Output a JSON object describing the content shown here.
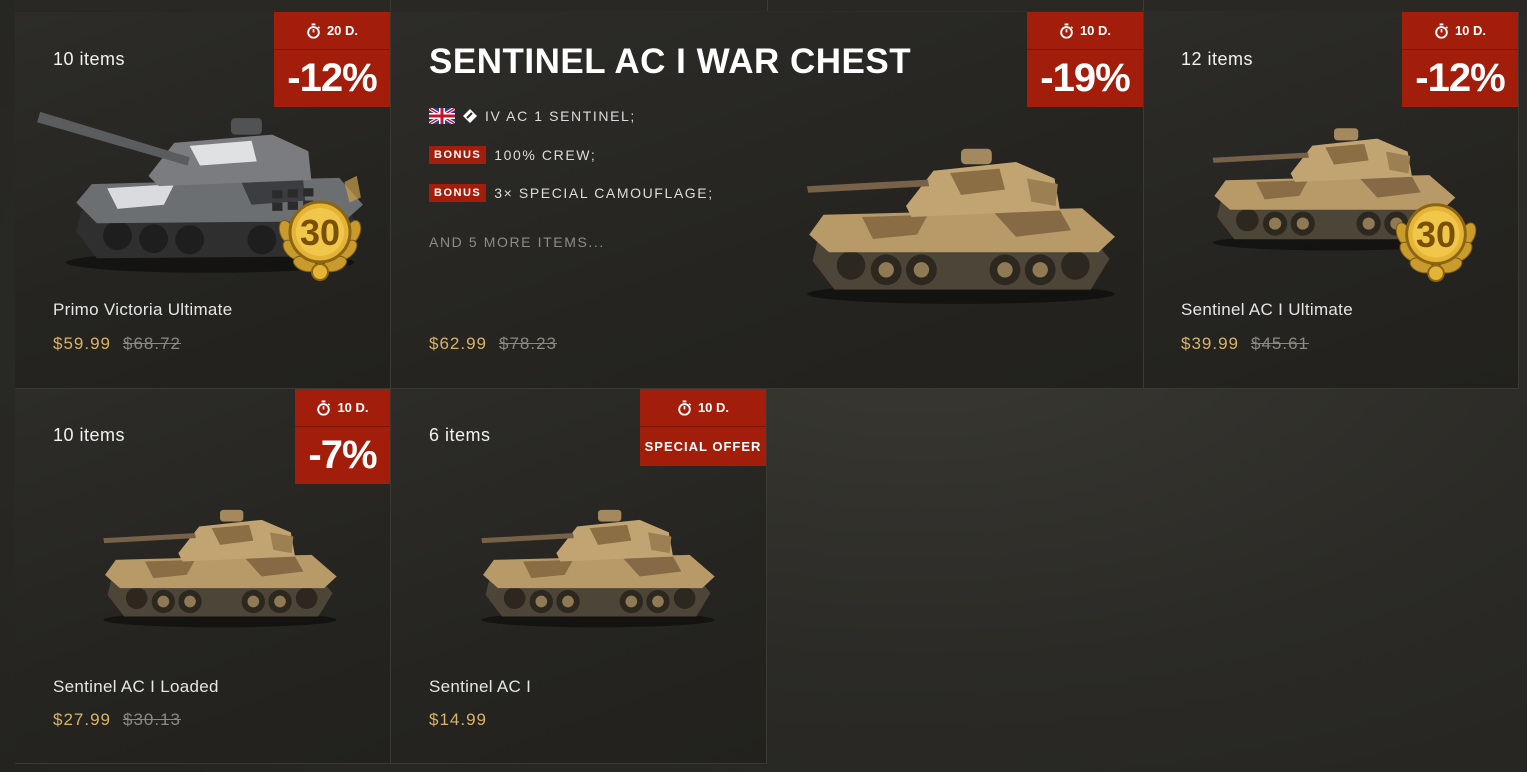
{
  "colors": {
    "badge": "#a21e0b",
    "price": "#d7b46a",
    "old_price": "#8a8a84"
  },
  "cards": [
    {
      "count": "10 items",
      "timer": "20 D.",
      "discount": "-12%",
      "name": "Primo Victoria Ultimate",
      "price": "$59.99",
      "old_price": "$68.72",
      "medal": "30"
    },
    {
      "title": "SENTINEL AC I WAR CHEST",
      "timer": "10 D.",
      "discount": "-19%",
      "features": [
        {
          "text": "IV  AC 1 SENTINEL;",
          "flag": "uk-flag-icon",
          "class_icon": "light-tank-icon"
        },
        {
          "badge": "BONUS",
          "text": "100% CREW;"
        },
        {
          "badge": "BONUS",
          "text": "3× SPECIAL CAMOUFLAGE;"
        }
      ],
      "more": "AND 5 MORE ITEMS...",
      "price": "$62.99",
      "old_price": "$78.23"
    },
    {
      "count": "12 items",
      "timer": "10 D.",
      "discount": "-12%",
      "name": "Sentinel AC I Ultimate",
      "price": "$39.99",
      "old_price": "$45.61",
      "medal": "30"
    },
    {
      "count": "10 items",
      "timer": "10 D.",
      "discount": "-7%",
      "name": "Sentinel AC I Loaded",
      "price": "$27.99",
      "old_price": "$30.13"
    },
    {
      "count": "6 items",
      "timer": "10 D.",
      "special": "SPECIAL OFFER",
      "name": "Sentinel AC I",
      "price": "$14.99"
    }
  ]
}
